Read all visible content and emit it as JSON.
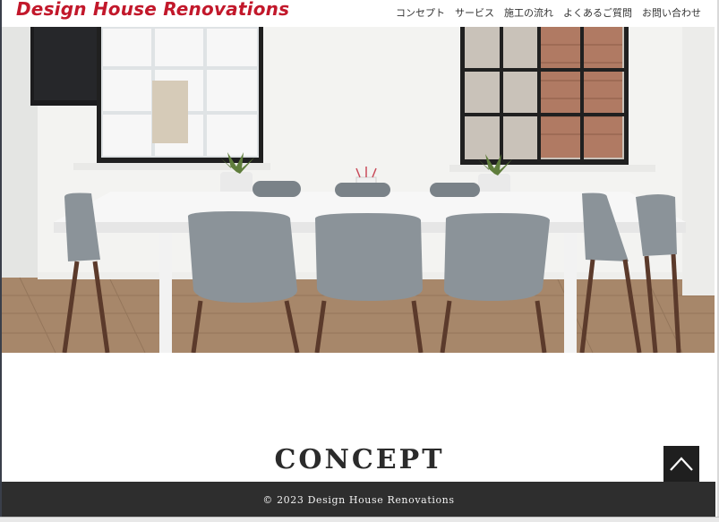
{
  "header": {
    "logo": "Design House Renovations",
    "nav": [
      {
        "label": "コンセプト"
      },
      {
        "label": "サービス"
      },
      {
        "label": "施工の流れ"
      },
      {
        "label": "よくあるご質問"
      },
      {
        "label": "お問い合わせ"
      }
    ]
  },
  "hero": {
    "icon": "dining-room-photo"
  },
  "concept": {
    "heading": "CONCEPT"
  },
  "footer": {
    "copyright": "© 2023 Design House Renovations"
  },
  "to_top": {
    "icon": "chevron-up-icon"
  },
  "colors": {
    "brand": "#c2182b",
    "footer_bg": "#2e2e2e",
    "to_top_bg": "#1f1f1f"
  }
}
